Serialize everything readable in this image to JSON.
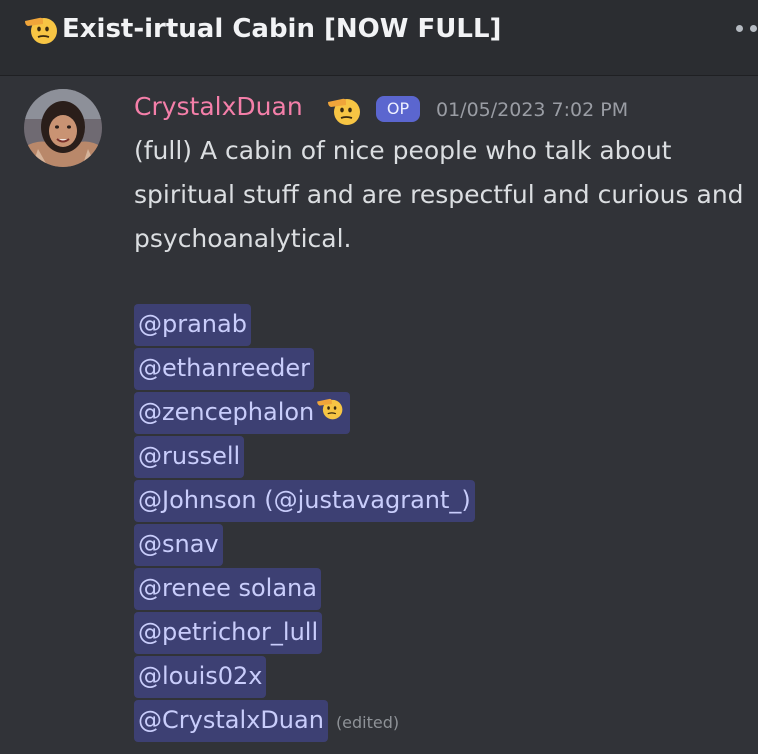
{
  "header": {
    "emoji": "saluting-face-emoji",
    "title": "Exist-irtual Cabin [NOW FULL]"
  },
  "message": {
    "username": "CrystalxDuan",
    "name_emoji": "saluting-face-emoji",
    "badge": "OP",
    "timestamp": "01/05/2023 7:02 PM",
    "body": "(full) A cabin of nice people who talk about spiritual stuff and are respectful and curious and psychoanalytical.",
    "mentions": [
      "@pranab",
      "@ethanreeder",
      "@zencephalon",
      "@russell",
      "@Johnson (@justavagrant_)",
      "@snav",
      "@renee solana",
      "@petrichor_lull",
      "@louis02x",
      "@CrystalxDuan"
    ],
    "edited_label": "(edited)"
  },
  "colors": {
    "background": "#313338",
    "header_bg": "#2b2d31",
    "username": "#f47fa9",
    "mention_bg": "#3d4073",
    "mention_text": "#c9cdfb",
    "op_badge": "#5b66cf"
  }
}
